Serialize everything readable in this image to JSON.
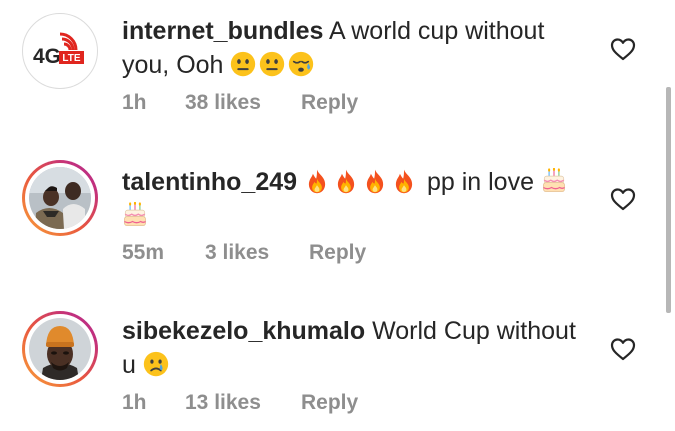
{
  "comments": [
    {
      "username": "internet_bundles",
      "text": "A world cup without you, Ooh",
      "emojis": [
        "neutral-face",
        "neutral-face",
        "sleepy-face"
      ],
      "time": "1h",
      "likes": "38 likes",
      "reply": "Reply",
      "avatar": "4g-lte-logo",
      "logo_text": "4G",
      "logo_sub": "LTE"
    },
    {
      "username": "talentinho_249",
      "text": "pp  in  love",
      "emojis_before": [
        "fire",
        "fire",
        "fire",
        "fire"
      ],
      "emojis_after": [
        "birthday-cake",
        "birthday-cake"
      ],
      "time": "55m",
      "likes": "3 likes",
      "reply": "Reply",
      "avatar": "photo-two-people"
    },
    {
      "username": "sibekezelo_khumalo",
      "text": "World Cup without u",
      "emojis": [
        "crying-face"
      ],
      "time": "1h",
      "likes": "13 likes",
      "reply": "Reply",
      "avatar": "photo-person-orange-beanie"
    }
  ],
  "colors": {
    "text": "#262626",
    "meta": "#8e8e8e",
    "story_ring_start": "#f9a23a",
    "story_ring_end": "#b22d8d",
    "logo_red": "#e0261f"
  }
}
